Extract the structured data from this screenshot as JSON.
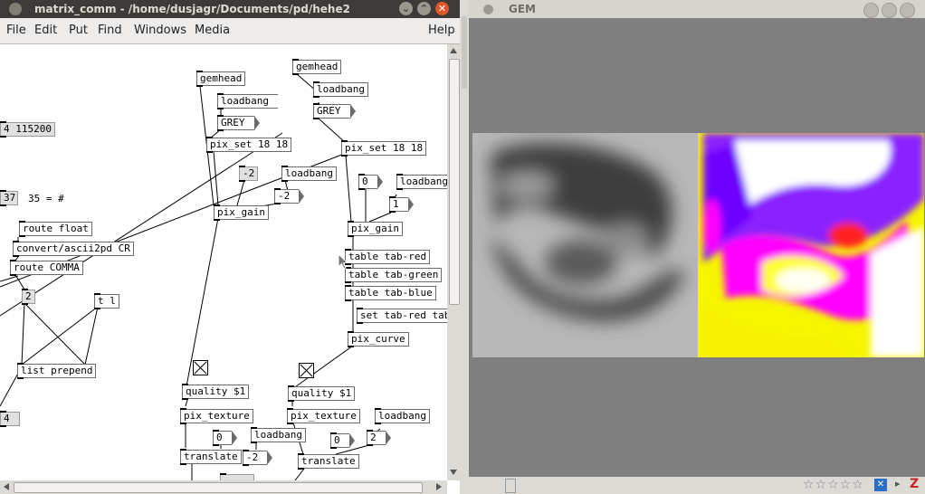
{
  "pd_window": {
    "title": "matrix_comm  - /home/dusjagr/Documents/pd/hehe2",
    "menu": [
      "File",
      "Edit",
      "Put",
      "Find",
      "Windows",
      "Media"
    ],
    "help": "Help",
    "objects": {
      "gemhead1": "gemhead",
      "loadbang1": "loadbang",
      "grey1": "GREY",
      "pixset1": "pix_set 18 18",
      "baud": "4 115200",
      "num_m2": "-2",
      "loadbang2": "loadbang",
      "num_m2b": "-2",
      "pixgain1": "pix_gain",
      "n37": "37",
      "eq35": "35 = #",
      "routefloat": "route float",
      "convert": "convert/ascii2pd CR",
      "routecomma": "route COMMA",
      "n2": "2",
      "tl": "t l",
      "listprepend": "list prepend",
      "quality1": "quality $1",
      "pixtexture1": "pix_texture",
      "n0a": "0",
      "loadbang3": "loadbang",
      "translate1": "translate",
      "num_m2c": "-2",
      "n4": "4",
      "gemhead2": "gemhead",
      "loadbang4": "loadbang",
      "grey2": "GREY",
      "pixset2": "pix_set 18 18",
      "n0b": "0",
      "loadbang5": "loadbang",
      "n1": "1",
      "pixgain2": "pix_gain",
      "tabred": "table tab-red",
      "tabgreen": "table tab-green",
      "tabblue": "table tab-blue",
      "settabred": "set tab-red tab-",
      "pixcurve": "pix_curve",
      "quality2": "quality $1",
      "pixtexture2": "pix_texture",
      "loadbang6": "loadbang",
      "n0c": "0",
      "n2b": "2",
      "translate2": "translate"
    }
  },
  "gem_window": {
    "title": "GEM"
  },
  "colors": {
    "titlebar": "#3c3b37",
    "gem_bg": "#7f7f7f",
    "close_button": "#e0562a"
  }
}
